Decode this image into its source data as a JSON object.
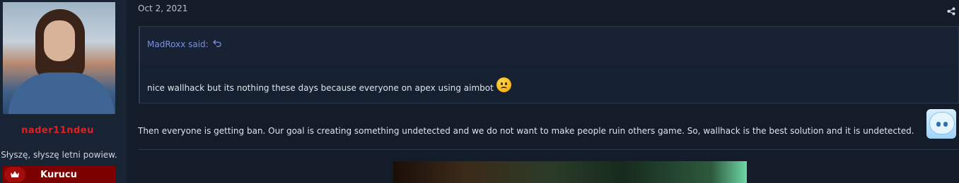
{
  "user": {
    "name": "nader11ndeu",
    "title": "Słyszę, słyszę letni powiew.",
    "banner": "Kurucu",
    "name_color": "#e02121",
    "banner_color": "#7d0000"
  },
  "post": {
    "date": "Oct 2, 2021",
    "quote": {
      "author": "MadRoxx said:",
      "text": "nice wallhack but its nothing these days because everyone on apex using aimbot",
      "emoji": "frown-emoji"
    },
    "reply": "Then everyone is getting ban. Our goal is creating something undetected and we do not want to make people ruin others game. So, wallhack is the best solution and it is undetected.",
    "reply_sticker": "anime-girl-sticker"
  },
  "icons": {
    "share": "share-icon",
    "quote_jump": "reply-arrow-icon",
    "banner": "crown-icon"
  },
  "colors": {
    "background": "#141c29",
    "quote_link": "#7b8fe3"
  }
}
